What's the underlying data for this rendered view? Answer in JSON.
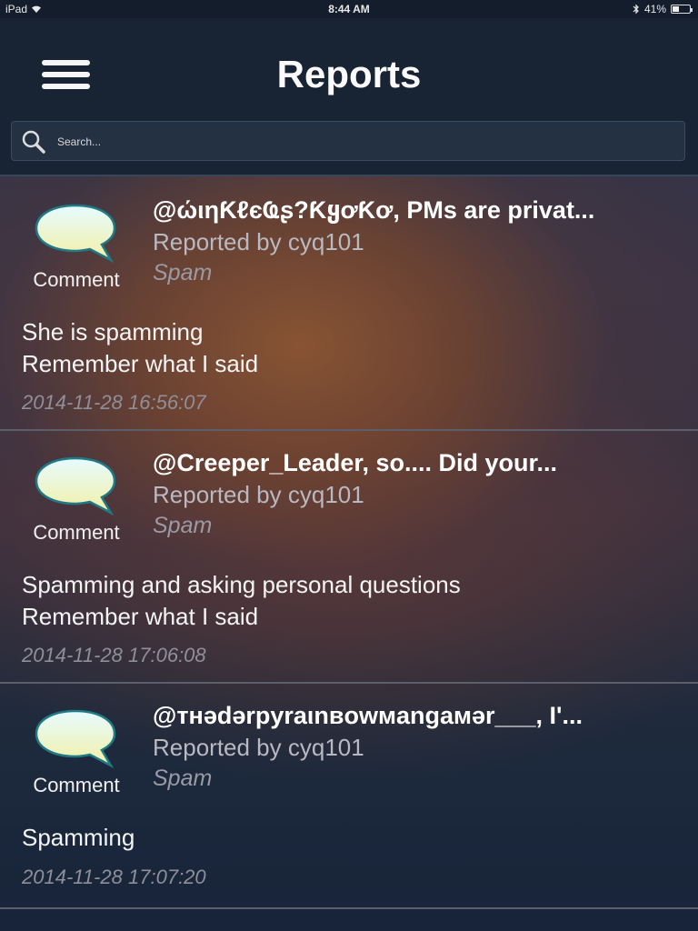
{
  "status_bar": {
    "device": "iPad",
    "time": "8:44 AM",
    "battery_percent_label": "41%",
    "battery_level": 0.41
  },
  "header": {
    "title": "Reports",
    "menu_icon": "hamburger-menu-icon"
  },
  "search": {
    "placeholder": "Search...",
    "value": ""
  },
  "reports": [
    {
      "type_label": "Comment",
      "icon": "speech-bubble-icon",
      "title": "@ώιηƘℓєҨʂ?ƘყơƘơ, PMs are privat...",
      "reporter": "Reported by cyq101",
      "category": "Spam",
      "body": [
        "She is spamming",
        "Remember what I said"
      ],
      "timestamp": "2014-11-28 16:56:07"
    },
    {
      "type_label": "Comment",
      "icon": "speech-bubble-icon",
      "title": "@Creeper_Leader, so.... Did your...",
      "reporter": "Reported by cyq101",
      "category": "Spam",
      "body": [
        "Spamming and asking personal questions",
        "Remember what I said"
      ],
      "timestamp": "2014-11-28 17:06:08"
    },
    {
      "type_label": "Comment",
      "icon": "speech-bubble-icon",
      "title": "@тнədərpyraιnвowмangaмər___, I'...",
      "reporter": "Reported by cyq101",
      "category": "Spam",
      "body": [
        "Spamming"
      ],
      "timestamp": "2014-11-28 17:07:20"
    }
  ],
  "colors": {
    "nav_background": "#182434",
    "bubble_fill_top": "#e6fbff",
    "bubble_fill_bottom": "#f3f0a6",
    "bubble_stroke": "#1f7a86"
  }
}
